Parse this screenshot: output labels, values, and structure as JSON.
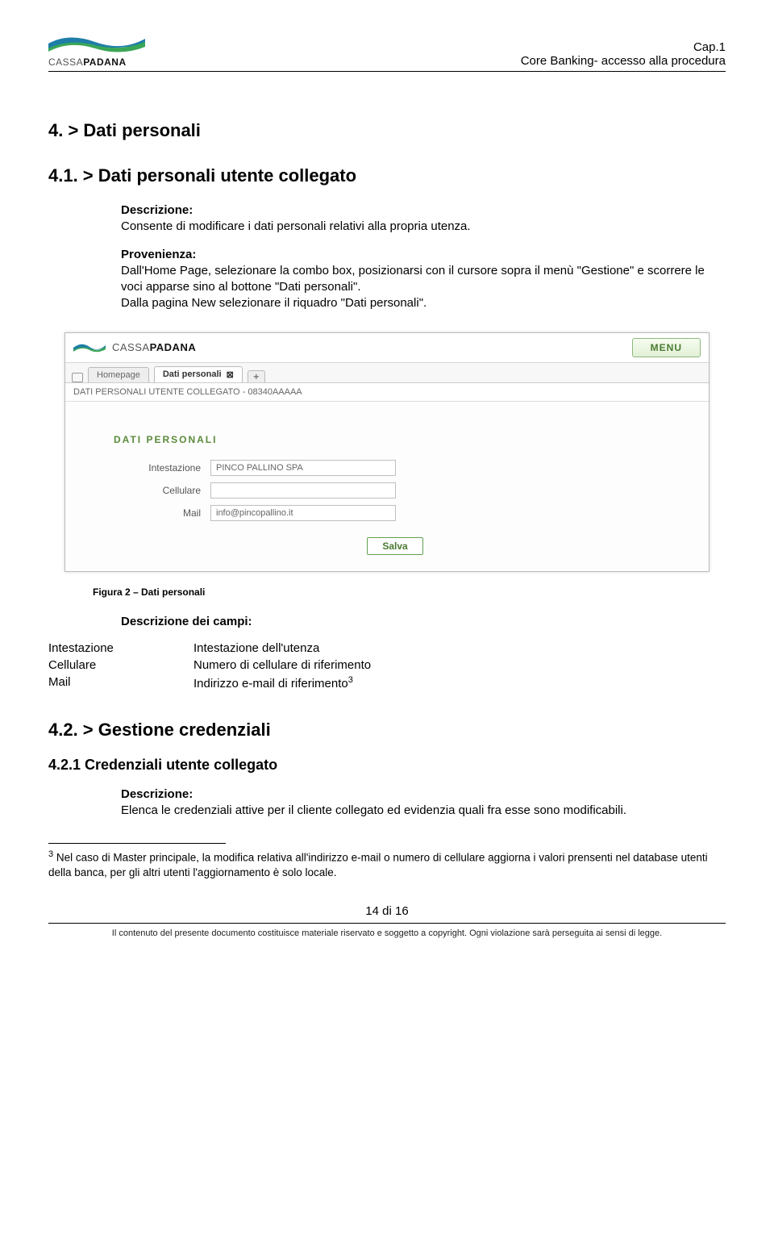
{
  "header": {
    "logo_cassa": "CASSA",
    "logo_padana": "PADANA",
    "cap": "Cap.1",
    "subtitle": "Core Banking- accesso alla procedura"
  },
  "h1": "4. >   Dati personali",
  "h2a": "4.1. >    Dati personali utente collegato",
  "desc_label": "Descrizione:",
  "desc_text": "Consente di modificare i dati personali relativi alla propria utenza.",
  "prov_label": "Provenienza:",
  "prov_text_1": "Dall'Home Page, selezionare la combo box, posizionarsi con il cursore sopra il menù \"Gestione\" e scorrere le voci apparse sino al bottone \"Dati personali\".",
  "prov_text_2": "Dalla pagina New selezionare il riquadro \"Dati personali\".",
  "app": {
    "logo_cassa": "CASSA",
    "logo_padana": "PADANA",
    "menu": "MENU",
    "tab_home": "Homepage",
    "tab_active": "Dati personali",
    "tab_add": "+",
    "subbar": "DATI PERSONALI UTENTE COLLEGATO - 08340AAAAA",
    "panel_title": "DATI PERSONALI",
    "rows": {
      "intestazione_label": "Intestazione",
      "intestazione_value": "PINCO PALLINO SPA",
      "cellulare_label": "Cellulare",
      "cellulare_value": "",
      "mail_label": "Mail",
      "mail_value": "info@pincopallino.it"
    },
    "save": "Salva"
  },
  "figure_caption": "Figura 2 – Dati personali",
  "fields_heading": "Descrizione dei campi:",
  "fields": {
    "intestazione_k": "Intestazione",
    "intestazione_v": "Intestazione dell'utenza",
    "cellulare_k": "Cellulare",
    "cellulare_v": "Numero di cellulare di riferimento",
    "mail_k": "Mail",
    "mail_v_pre": "Indirizzo e-mail di riferimento",
    "mail_sup": "3"
  },
  "h2b": "4.2. >    Gestione credenziali",
  "h3": "4.2.1   Credenziali utente collegato",
  "desc2_label": "Descrizione:",
  "desc2_text": "Elenca le credenziali attive per il cliente collegato ed evidenzia quali fra esse sono modificabili.",
  "footnote_marker": "3",
  "footnote_text": " Nel caso di Master principale, la modifica relativa all'indirizzo e-mail o numero di cellulare aggiorna i valori prensenti nel database utenti della banca, per gli altri utenti l'aggiornamento è solo locale.",
  "page_num": "14 di 16",
  "copyright": "Il contenuto del presente documento costituisce materiale riservato e soggetto a copyright. Ogni violazione sarà perseguita ai sensi di legge."
}
